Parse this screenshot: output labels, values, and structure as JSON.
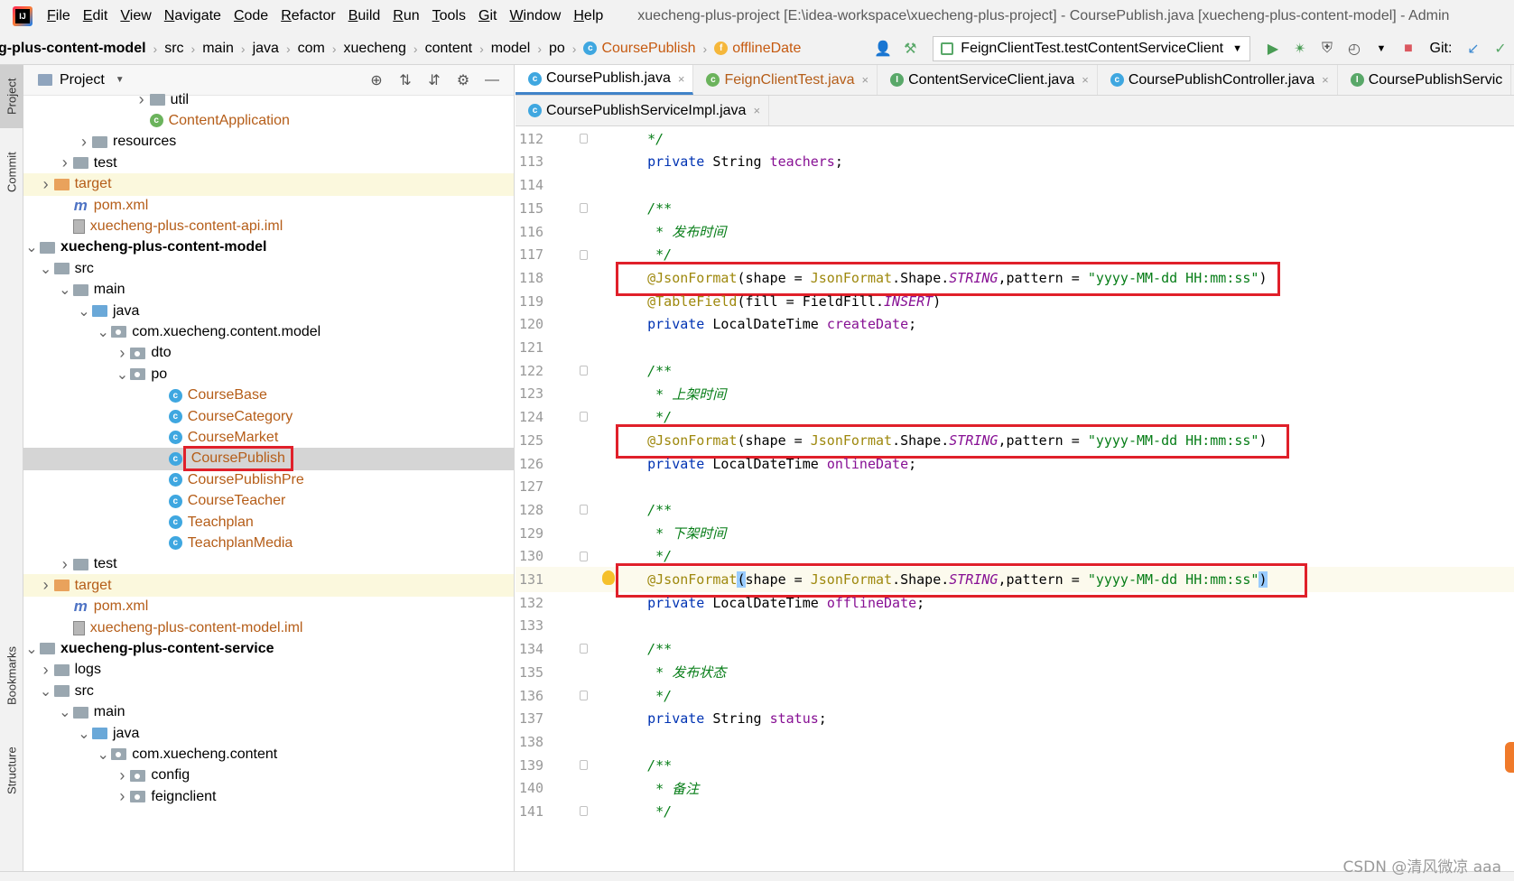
{
  "menubar": {
    "items": [
      {
        "label": "File",
        "mnemonic": "F",
        "rest": "ile"
      },
      {
        "label": "Edit",
        "mnemonic": "E",
        "rest": "dit"
      },
      {
        "label": "View",
        "mnemonic": "V",
        "rest": "iew"
      },
      {
        "label": "Navigate",
        "mnemonic": "N",
        "rest": "avigate"
      },
      {
        "label": "Code",
        "mnemonic": "C",
        "rest": "ode"
      },
      {
        "label": "Refactor",
        "mnemonic": "R",
        "rest": "efactor"
      },
      {
        "label": "Build",
        "mnemonic": "B",
        "rest": "uild"
      },
      {
        "label": "Run",
        "mnemonic": "R",
        "rest": "un"
      },
      {
        "label": "Tools",
        "mnemonic": "T",
        "rest": "ools"
      },
      {
        "label": "Git",
        "mnemonic": "G",
        "rest": "it"
      },
      {
        "label": "Window",
        "mnemonic": "W",
        "rest": "indow"
      },
      {
        "label": "Help",
        "mnemonic": "H",
        "rest": "elp"
      }
    ],
    "window_title": "xuecheng-plus-project [E:\\idea-workspace\\xuecheng-plus-project] - CoursePublish.java [xuecheng-plus-content-model] - Admin"
  },
  "navbar": {
    "crumbs": [
      "g-plus-content-model",
      "src",
      "main",
      "java",
      "com",
      "xuecheng",
      "content",
      "model",
      "po",
      "CoursePublish",
      "offlineDate"
    ],
    "run_config": "FeignClientTest.testContentServiceClient",
    "git_label": "Git:"
  },
  "left_strip": {
    "project": "Project",
    "commit": "Commit",
    "bookmarks": "Bookmarks",
    "structure": "Structure"
  },
  "project_panel": {
    "title": "Project",
    "tree": [
      {
        "label": "util",
        "type": "folder",
        "indent": 8,
        "arrow": "›"
      },
      {
        "label": "ContentApplication",
        "type": "spring",
        "indent": 8,
        "arrow": "",
        "style": "orange"
      },
      {
        "label": "resources",
        "type": "folder-res",
        "indent": 5,
        "arrow": "›"
      },
      {
        "label": "test",
        "type": "folder",
        "indent": 4,
        "arrow": "›"
      },
      {
        "label": "target",
        "type": "folder-orange",
        "indent": 3,
        "arrow": "›",
        "style": "orange",
        "row": "yellow"
      },
      {
        "label": "pom.xml",
        "type": "maven",
        "indent": 4,
        "arrow": "",
        "style": "orange"
      },
      {
        "label": "xuecheng-plus-content-api.iml",
        "type": "iml",
        "indent": 4,
        "arrow": "",
        "style": "orange"
      },
      {
        "label": "xuecheng-plus-content-model",
        "type": "folder",
        "indent": 2,
        "arrow": "⌄",
        "style": "bold"
      },
      {
        "label": "src",
        "type": "folder",
        "indent": 3,
        "arrow": "⌄"
      },
      {
        "label": "main",
        "type": "folder",
        "indent": 4,
        "arrow": "⌄"
      },
      {
        "label": "java",
        "type": "folder-blue",
        "indent": 5,
        "arrow": "⌄"
      },
      {
        "label": "com.xuecheng.content.model",
        "type": "package",
        "indent": 6,
        "arrow": "⌄"
      },
      {
        "label": "dto",
        "type": "package",
        "indent": 7,
        "arrow": "›"
      },
      {
        "label": "po",
        "type": "package",
        "indent": 7,
        "arrow": "⌄"
      },
      {
        "label": "CourseBase",
        "type": "class",
        "indent": 9,
        "arrow": "",
        "style": "orange"
      },
      {
        "label": "CourseCategory",
        "type": "class",
        "indent": 9,
        "arrow": "",
        "style": "orange"
      },
      {
        "label": "CourseMarket",
        "type": "class",
        "indent": 9,
        "arrow": "",
        "style": "orange"
      },
      {
        "label": "CoursePublish",
        "type": "class",
        "indent": 9,
        "arrow": "",
        "style": "orange",
        "row": "selected",
        "boxed": true
      },
      {
        "label": "CoursePublishPre",
        "type": "class",
        "indent": 9,
        "arrow": "",
        "style": "orange"
      },
      {
        "label": "CourseTeacher",
        "type": "class",
        "indent": 9,
        "arrow": "",
        "style": "orange"
      },
      {
        "label": "Teachplan",
        "type": "class",
        "indent": 9,
        "arrow": "",
        "style": "orange"
      },
      {
        "label": "TeachplanMedia",
        "type": "class",
        "indent": 9,
        "arrow": "",
        "style": "orange"
      },
      {
        "label": "test",
        "type": "folder",
        "indent": 4,
        "arrow": "›"
      },
      {
        "label": "target",
        "type": "folder-orange",
        "indent": 3,
        "arrow": "›",
        "style": "orange",
        "row": "yellow"
      },
      {
        "label": "pom.xml",
        "type": "maven",
        "indent": 4,
        "arrow": "",
        "style": "orange"
      },
      {
        "label": "xuecheng-plus-content-model.iml",
        "type": "iml",
        "indent": 4,
        "arrow": "",
        "style": "orange"
      },
      {
        "label": "xuecheng-plus-content-service",
        "type": "folder",
        "indent": 2,
        "arrow": "⌄",
        "style": "bold"
      },
      {
        "label": "logs",
        "type": "folder",
        "indent": 3,
        "arrow": "›"
      },
      {
        "label": "src",
        "type": "folder",
        "indent": 3,
        "arrow": "⌄"
      },
      {
        "label": "main",
        "type": "folder",
        "indent": 4,
        "arrow": "⌄"
      },
      {
        "label": "java",
        "type": "folder-blue",
        "indent": 5,
        "arrow": "⌄"
      },
      {
        "label": "com.xuecheng.content",
        "type": "package",
        "indent": 6,
        "arrow": "⌄"
      },
      {
        "label": "config",
        "type": "package",
        "indent": 7,
        "arrow": "›"
      },
      {
        "label": "feignclient",
        "type": "package",
        "indent": 7,
        "arrow": "›"
      }
    ]
  },
  "editor": {
    "tabs_row1": [
      {
        "label": "CoursePublish.java",
        "icon": "class",
        "active": true
      },
      {
        "label": "FeignClientTest.java",
        "icon": "test",
        "orange": true
      },
      {
        "label": "ContentServiceClient.java",
        "icon": "interface"
      },
      {
        "label": "CoursePublishController.java",
        "icon": "class"
      },
      {
        "label": "CoursePublishServic",
        "icon": "interface"
      }
    ],
    "tabs_row2": [
      {
        "label": "CoursePublishServiceImpl.java",
        "icon": "class"
      }
    ],
    "lines": [
      {
        "n": "112",
        "code": [
          [
            "k-com",
            "    */"
          ]
        ]
      },
      {
        "n": "113",
        "code": [
          [
            "k-kw",
            "    private "
          ],
          [
            "",
            "String "
          ],
          [
            "k-fld",
            "teachers"
          ],
          [
            "",
            ";"
          ]
        ]
      },
      {
        "n": "114",
        "code": []
      },
      {
        "n": "115",
        "code": [
          [
            "k-com",
            "    /**"
          ]
        ]
      },
      {
        "n": "116",
        "code": [
          [
            "k-com",
            "     * 发布时间"
          ]
        ]
      },
      {
        "n": "117",
        "code": [
          [
            "k-com",
            "     */"
          ]
        ]
      },
      {
        "n": "118",
        "code": [
          [
            "k-ann",
            "    @JsonFormat"
          ],
          [
            "",
            "(shape = "
          ],
          [
            "k-ann",
            "JsonFormat"
          ],
          [
            "",
            ".Shape."
          ],
          [
            "k-const",
            "STRING"
          ],
          [
            "",
            ",pattern = "
          ],
          [
            "k-str",
            "\"yyyy-MM-dd HH:mm:ss\""
          ],
          [
            "",
            ")"
          ]
        ]
      },
      {
        "n": "119",
        "code": [
          [
            "k-ann",
            "    @TableField"
          ],
          [
            "",
            "(fill = FieldFill."
          ],
          [
            "k-const",
            "INSERT"
          ],
          [
            "",
            ")"
          ]
        ]
      },
      {
        "n": "120",
        "code": [
          [
            "k-kw",
            "    private "
          ],
          [
            "",
            "LocalDateTime "
          ],
          [
            "k-fld",
            "createDate"
          ],
          [
            "",
            ";"
          ]
        ]
      },
      {
        "n": "121",
        "code": []
      },
      {
        "n": "122",
        "code": [
          [
            "k-com",
            "    /**"
          ]
        ]
      },
      {
        "n": "123",
        "code": [
          [
            "k-com",
            "     * 上架时间"
          ]
        ]
      },
      {
        "n": "124",
        "code": [
          [
            "k-com",
            "     */"
          ]
        ]
      },
      {
        "n": "125",
        "code": [
          [
            "k-ann",
            "    @JsonFormat"
          ],
          [
            "",
            "(shape = "
          ],
          [
            "k-ann",
            "JsonFormat"
          ],
          [
            "",
            ".Shape."
          ],
          [
            "k-const",
            "STRING"
          ],
          [
            "",
            ",pattern = "
          ],
          [
            "k-str",
            "\"yyyy-MM-dd HH:mm:ss\""
          ],
          [
            "",
            ")"
          ]
        ]
      },
      {
        "n": "126",
        "code": [
          [
            "k-kw",
            "    private "
          ],
          [
            "",
            "LocalDateTime "
          ],
          [
            "k-fld",
            "onlineDate"
          ],
          [
            "",
            ";"
          ]
        ]
      },
      {
        "n": "127",
        "code": []
      },
      {
        "n": "128",
        "code": [
          [
            "k-com",
            "    /**"
          ]
        ]
      },
      {
        "n": "129",
        "code": [
          [
            "k-com",
            "     * 下架时间"
          ]
        ]
      },
      {
        "n": "130",
        "code": [
          [
            "k-com",
            "     */"
          ]
        ]
      },
      {
        "n": "131",
        "code": [
          [
            "k-ann",
            "    @JsonFormat"
          ],
          [
            "paren-match",
            "("
          ],
          [
            "",
            "shape = "
          ],
          [
            "k-ann",
            "JsonFormat"
          ],
          [
            "",
            ".Shape."
          ],
          [
            "k-const",
            "STRING"
          ],
          [
            "",
            ",pattern = "
          ],
          [
            "k-str",
            "\"yyyy-MM-dd HH:mm:ss\""
          ],
          [
            "paren-match",
            ")"
          ]
        ],
        "current": true
      },
      {
        "n": "132",
        "code": [
          [
            "k-kw",
            "    private "
          ],
          [
            "",
            "LocalDateTime "
          ],
          [
            "k-fld",
            "offlineDate"
          ],
          [
            "",
            ";"
          ]
        ]
      },
      {
        "n": "133",
        "code": []
      },
      {
        "n": "134",
        "code": [
          [
            "k-com",
            "    /**"
          ]
        ]
      },
      {
        "n": "135",
        "code": [
          [
            "k-com",
            "     * 发布状态"
          ]
        ]
      },
      {
        "n": "136",
        "code": [
          [
            "k-com",
            "     */"
          ]
        ]
      },
      {
        "n": "137",
        "code": [
          [
            "k-kw",
            "    private "
          ],
          [
            "",
            "String "
          ],
          [
            "k-fld",
            "status"
          ],
          [
            "",
            ";"
          ]
        ]
      },
      {
        "n": "138",
        "code": []
      },
      {
        "n": "139",
        "code": [
          [
            "k-com",
            "    /**"
          ]
        ]
      },
      {
        "n": "140",
        "code": [
          [
            "k-com",
            "     * 备注"
          ]
        ]
      },
      {
        "n": "141",
        "code": [
          [
            "k-com",
            "     */"
          ]
        ]
      }
    ]
  },
  "watermark": "CSDN @清风微凉 aaa",
  "colors": {
    "highlight_box": "#e0202a",
    "keyword": "#0033b3",
    "annotation": "#9e880d",
    "string": "#067d17",
    "field": "#871094"
  }
}
